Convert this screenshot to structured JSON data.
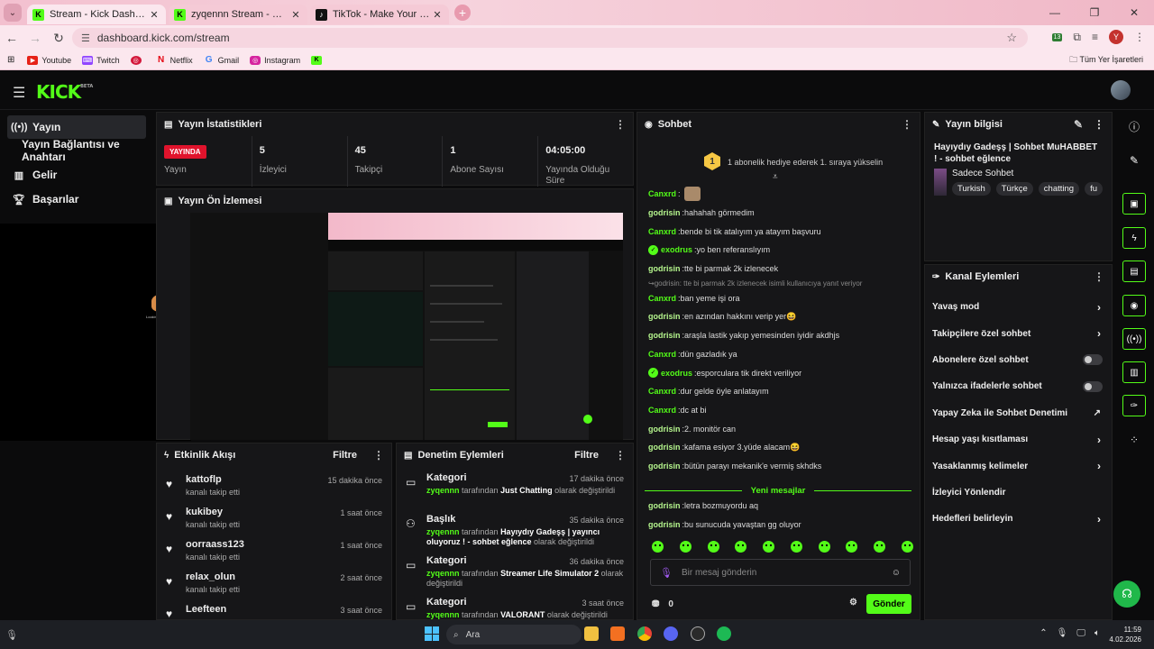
{
  "browser": {
    "tabs": [
      {
        "title": "Stream - Kick Dashboard",
        "favicon": "kick-icon",
        "active": true
      },
      {
        "title": "zyqennn Stream - Watch Live o",
        "favicon": "kick-icon",
        "active": false
      },
      {
        "title": "TikTok - Make Your Day",
        "favicon": "tiktok-icon",
        "active": false
      }
    ],
    "url": "dashboard.kick.com/stream",
    "profile_initial": "Y",
    "extension_badge": "13",
    "bookmarks": [
      "Youtube",
      "Twitch",
      "",
      "Netflix",
      "Gmail",
      "Instagram",
      ""
    ],
    "all_bookmarks": "Tüm Yer İşaretleri"
  },
  "app": {
    "logo": "KICK",
    "logo_badge": "BETA",
    "sidebar": [
      {
        "label": "Yayın",
        "icon": "broadcast-icon"
      },
      {
        "label": "Yayın Bağlantısı ve Anahtarı",
        "icon": ""
      },
      {
        "label": "Gelir",
        "icon": "chart-icon"
      },
      {
        "label": "Başarılar",
        "icon": "trophy-icon"
      }
    ],
    "preview_caption": "Looking for the phone"
  },
  "stats_panel": {
    "title": "Yayın İstatistikleri",
    "items": [
      {
        "value": "YAYINDA",
        "label": "Yayın"
      },
      {
        "value": "5",
        "label": "İzleyici"
      },
      {
        "value": "45",
        "label": "Takipçi"
      },
      {
        "value": "1",
        "label": "Abone Sayısı"
      },
      {
        "value": "04:05:00",
        "label": "Yayında Olduğu Süre"
      }
    ]
  },
  "preview_panel": {
    "title": "Yayın Ön İzlemesi"
  },
  "events_panel": {
    "title": "Etkinlik Akışı",
    "filter": "Filtre",
    "events": [
      {
        "name": "kattoflp",
        "sub": "kanalı takip etti",
        "time": "15 dakika önce"
      },
      {
        "name": "kukibey",
        "sub": "kanalı takip etti",
        "time": "1 saat önce"
      },
      {
        "name": "oorraass123",
        "sub": "kanalı takip etti",
        "time": "1 saat önce"
      },
      {
        "name": "relax_olun",
        "sub": "kanalı takip etti",
        "time": "2 saat önce"
      },
      {
        "name": "Leefteen",
        "sub": "",
        "time": "3 saat önce"
      }
    ]
  },
  "moderation_panel": {
    "title": "Denetim Eylemleri",
    "filter": "Filtre",
    "actions": [
      {
        "type": "Kategori",
        "time": "17 dakika önce",
        "user": "zyqennn",
        "mid": " tarafından ",
        "value": "Just Chatting",
        "end": " olarak değiştirildi"
      },
      {
        "type": "Başlık",
        "time": "35 dakika önce",
        "user": "zyqennn",
        "mid": " tarafından ",
        "value": "Hayıydıy Gadeşş | yayıncı oluyoruz ! - sohbet eğlence",
        "end": " olarak değiştirildi"
      },
      {
        "type": "Kategori",
        "time": "36 dakika önce",
        "user": "zyqennn",
        "mid": " tarafından ",
        "value": "Streamer Life Simulator 2",
        "end": " olarak değiştirildi"
      },
      {
        "type": "Kategori",
        "time": "3 saat önce",
        "user": "zyqennn",
        "mid": " tarafından ",
        "value": "VALORANT",
        "end": " olarak değiştirildi"
      }
    ]
  },
  "chat": {
    "title": "Sohbet",
    "pinned_badge": "1",
    "pinned": "1 abonelik hediye ederek 1. sıraya yükselin",
    "messages": [
      {
        "user": "Canxrd",
        "text": "",
        "verified": false,
        "reply": false
      },
      {
        "user": "godrisin",
        "text": "hahahah görmedim",
        "verified": false,
        "reply": false
      },
      {
        "user": "Canxrd",
        "text": "bende bi tik atalıyım ya atayım başvuru",
        "verified": false,
        "reply": false
      },
      {
        "user": "exodrus",
        "text": "yo ben referanslıyım",
        "verified": true,
        "reply": false
      },
      {
        "user": "godrisin",
        "text": "tte bi parmak 2k izlenecek",
        "verified": false,
        "reply": false
      },
      {
        "user": "",
        "text": "godrisin: tte bi parmak 2k izlenecek isimli kullanıcıya yanıt veriyor",
        "verified": false,
        "reply": true
      },
      {
        "user": "Canxrd",
        "text": "ban yeme işi ora",
        "verified": false,
        "reply": false
      },
      {
        "user": "godrisin",
        "text": "en azından hakkını verip yer😆",
        "verified": false,
        "reply": false
      },
      {
        "user": "godrisin",
        "text": "araşla lastik yakıp yemesinden iyidir akdhjs",
        "verified": false,
        "reply": false
      },
      {
        "user": "Canxrd",
        "text": "dün gazladık ya",
        "verified": false,
        "reply": false
      },
      {
        "user": "exodrus",
        "text": "esporculara tik direkt veriliyor",
        "verified": true,
        "reply": false
      },
      {
        "user": "Canxrd",
        "text": "dur gelde öyle anlatayım",
        "verified": false,
        "reply": false
      },
      {
        "user": "Canxrd",
        "text": "dc at bi",
        "verified": false,
        "reply": false
      },
      {
        "user": "godrisin",
        "text": "2. monitör can",
        "verified": false,
        "reply": false
      },
      {
        "user": "godrisin",
        "text": "kafama esiyor 3.yüde alacam😆",
        "verified": false,
        "reply": false
      },
      {
        "user": "godrisin",
        "text": "bütün parayı mekanik'e vermiş skhdks",
        "verified": false,
        "reply": false
      }
    ],
    "new_messages_label": "Yeni mesajlar",
    "new_messages": [
      {
        "user": "godrisin",
        "text": "letra bozmuyordu aq"
      },
      {
        "user": "godrisin",
        "text": "bu sunucuda yavaştan gg oluyor"
      }
    ],
    "input_placeholder": "Bir mesaj gönderin",
    "points": "0",
    "send_label": "Gönder"
  },
  "stream_info": {
    "title": "Yayın bilgisi",
    "stream_title": "Hayıydıy Gadeşş | Sohbet MuHABBET ! - sohbet eğlence",
    "category": "Sadece Sohbet",
    "tags": [
      "Turkish",
      "Türkçe",
      "chatting",
      "fu"
    ]
  },
  "channel_actions": {
    "title": "Kanal Eylemleri",
    "items": [
      {
        "label": "Yavaş mod",
        "control": "chevron"
      },
      {
        "label": "Takipçilere özel sohbet",
        "control": "chevron"
      },
      {
        "label": "Abonelere özel sohbet",
        "control": "toggle"
      },
      {
        "label": "Yalnızca ifadelerle sohbet",
        "control": "toggle"
      },
      {
        "label": "Yapay Zeka ile Sohbet Denetimi",
        "control": "external"
      },
      {
        "label": "Hesap yaşı kısıtlaması",
        "control": "chevron"
      },
      {
        "label": "Yasaklanmış kelimeler",
        "control": "chevron"
      },
      {
        "label": "İzleyici Yönlendir",
        "control": "none"
      },
      {
        "label": "Hedefleri belirleyin",
        "control": "chevron"
      }
    ]
  },
  "taskbar": {
    "search_placeholder": "Ara",
    "time": "11:59",
    "date": "4.02.2026"
  },
  "colors": {
    "accent": "#53fc18",
    "live": "#e0132c",
    "panel": "#161618",
    "chrome": "#fbe7ee"
  }
}
